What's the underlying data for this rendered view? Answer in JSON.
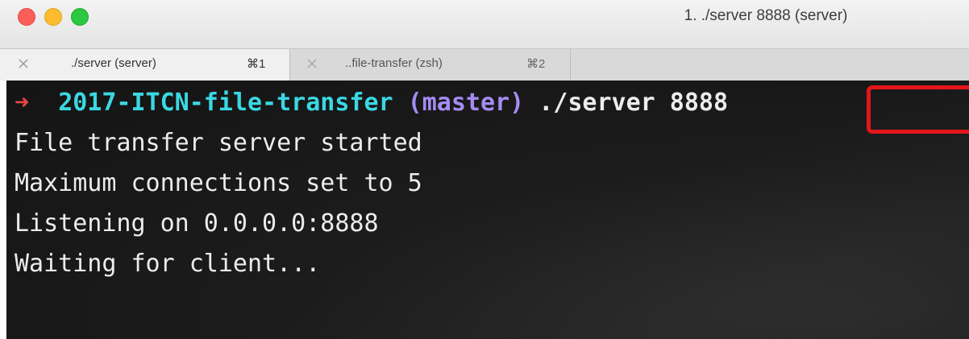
{
  "window": {
    "title": "1. ./server 8888 (server)"
  },
  "tabs": [
    {
      "label": "./server (server)",
      "shortcut": "⌘1",
      "close": "×"
    },
    {
      "label": "..file-transfer (zsh)",
      "shortcut": "⌘2",
      "close": "×"
    }
  ],
  "terminal": {
    "prompt": {
      "arrow": "➜",
      "directory": "2017-ITCN-file-transfer",
      "branch": "(master)",
      "command": "./server",
      "argument": "8888"
    },
    "lines": [
      "File transfer server started",
      "Maximum connections set to 5",
      "Listening on 0.0.0.0:8888",
      "Waiting for client..."
    ]
  },
  "colors": {
    "close_button": "#fc5f57",
    "minimize_button": "#fdbc2e",
    "zoom_button": "#2bc840",
    "prompt_arrow": "#e84542",
    "directory": "#3ad8e3",
    "branch": "#a58cf3",
    "highlight": "#e3161a"
  },
  "icons": {
    "close_button": "close-window-icon",
    "minimize_button": "minimize-window-icon",
    "zoom_button": "zoom-window-icon",
    "tab_close": "close-tab-icon"
  }
}
